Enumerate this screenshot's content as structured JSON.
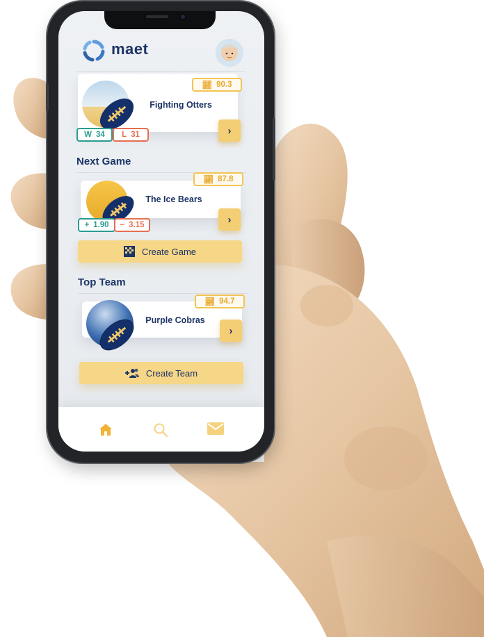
{
  "app": {
    "name": "maet"
  },
  "featured": {
    "name": "Fighting Otters",
    "rating": "90.3",
    "wins_label": "W",
    "wins": "34",
    "losses_label": "L",
    "losses": "31"
  },
  "next_game": {
    "section_title": "Next Game",
    "name": "The Ice Bears",
    "rating": "87.8",
    "plus_label": "+",
    "plus_value": "1.90",
    "minus_label": "−",
    "minus_value": "3.15",
    "create_label": "Create Game"
  },
  "top_team": {
    "section_title": "Top Team",
    "name": "Purple Cobras",
    "rating": "94.7",
    "create_label": "Create Team"
  },
  "chevron": "›",
  "icons": {
    "logo": "ring-logo-icon",
    "avatar": "user-avatar",
    "rating": "trend-chart-icon",
    "next": "chevron-right-icon",
    "game": "checkered-flag-icon",
    "team": "add-group-icon",
    "home": "home-icon",
    "search": "search-icon",
    "mail": "mail-icon"
  },
  "colors": {
    "navy": "#1d3566",
    "gold": "#f4ce74",
    "win": "#2a9d8f",
    "loss": "#e76f51",
    "active_tab": "#f2b233"
  }
}
